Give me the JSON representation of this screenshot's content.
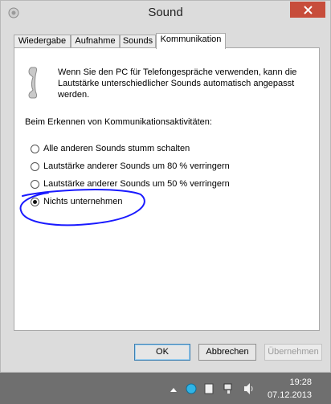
{
  "window": {
    "title": "Sound"
  },
  "tabs": [
    {
      "label": "Wiedergabe"
    },
    {
      "label": "Aufnahme"
    },
    {
      "label": "Sounds"
    },
    {
      "label": "Kommunikation"
    }
  ],
  "panel": {
    "intro": "Wenn Sie den PC für Telefongespräche verwenden, kann die Lautstärke unterschiedlicher Sounds automatisch angepasst werden.",
    "section_label": "Beim Erkennen von Kommunikationsaktivitäten:",
    "options": [
      {
        "label": "Alle anderen Sounds stumm schalten",
        "selected": false
      },
      {
        "label": "Lautstärke anderer Sounds um 80 % verringern",
        "selected": false
      },
      {
        "label": "Lautstärke anderer Sounds um 50 % verringern",
        "selected": false
      },
      {
        "label": "Nichts unternehmen",
        "selected": true
      }
    ]
  },
  "buttons": {
    "ok": "OK",
    "cancel": "Abbrechen",
    "apply": "Übernehmen"
  },
  "taskbar": {
    "time": "19:28",
    "date": "07.12.2013"
  },
  "colors": {
    "close": "#c74d3b",
    "annotation": "#1a1aff",
    "taskbar": "#6f6f6f"
  }
}
